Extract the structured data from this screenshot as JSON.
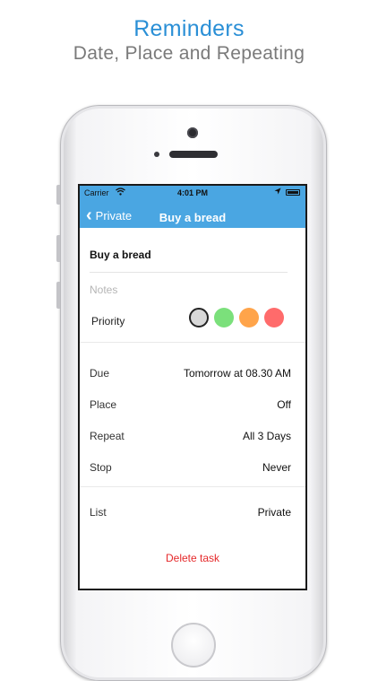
{
  "promo": {
    "title": "Reminders",
    "subtitle": "Date, Place and Repeating"
  },
  "status_bar": {
    "carrier": "Carrier",
    "time": "4:01 PM",
    "wifi_icon": "wifi-icon",
    "location_icon": "location-arrow-icon",
    "battery_icon": "battery-icon"
  },
  "nav_bar": {
    "back_label": "Private",
    "title": "Buy a bread",
    "color": "#4aa6e2"
  },
  "task": {
    "title": "Buy a bread",
    "notes_placeholder": "Notes",
    "priority_label": "Priority",
    "priority_colors": [
      "#d8d8d8",
      "#7be07b",
      "#ffa44a",
      "#ff6b6b"
    ]
  },
  "details": {
    "due": {
      "label": "Due",
      "value": "Tomorrow at 08.30 AM"
    },
    "place": {
      "label": "Place",
      "value": "Off"
    },
    "repeat": {
      "label": "Repeat",
      "value": "All 3 Days"
    },
    "stop": {
      "label": "Stop",
      "value": "Never"
    },
    "list": {
      "label": "List",
      "value": "Private"
    }
  },
  "actions": {
    "delete_label": "Delete task",
    "delete_color": "#e5292b"
  }
}
